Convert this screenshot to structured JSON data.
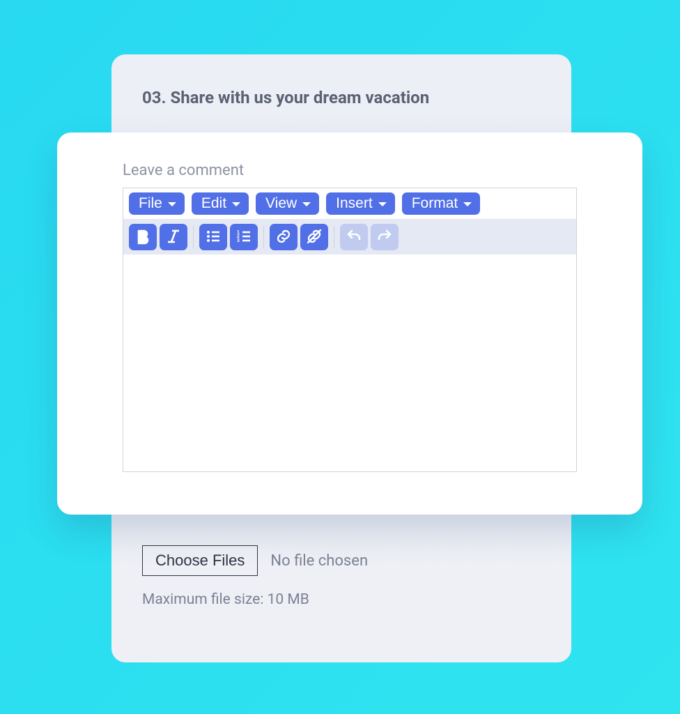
{
  "question": {
    "title": "03. Share with us your dream vacation"
  },
  "editor": {
    "label": "Leave a comment",
    "menus": {
      "file": "File",
      "edit": "Edit",
      "view": "View",
      "insert": "Insert",
      "format": "Format"
    },
    "tools": {
      "bold": "bold",
      "italic": "italic",
      "bullet_list": "bullet-list",
      "number_list": "numbered-list",
      "link": "link",
      "unlink": "unlink",
      "undo": "undo",
      "redo": "redo"
    }
  },
  "file": {
    "choose_label": "Choose Files",
    "status": "No file chosen",
    "note": "Maximum file size: 10 MB"
  }
}
